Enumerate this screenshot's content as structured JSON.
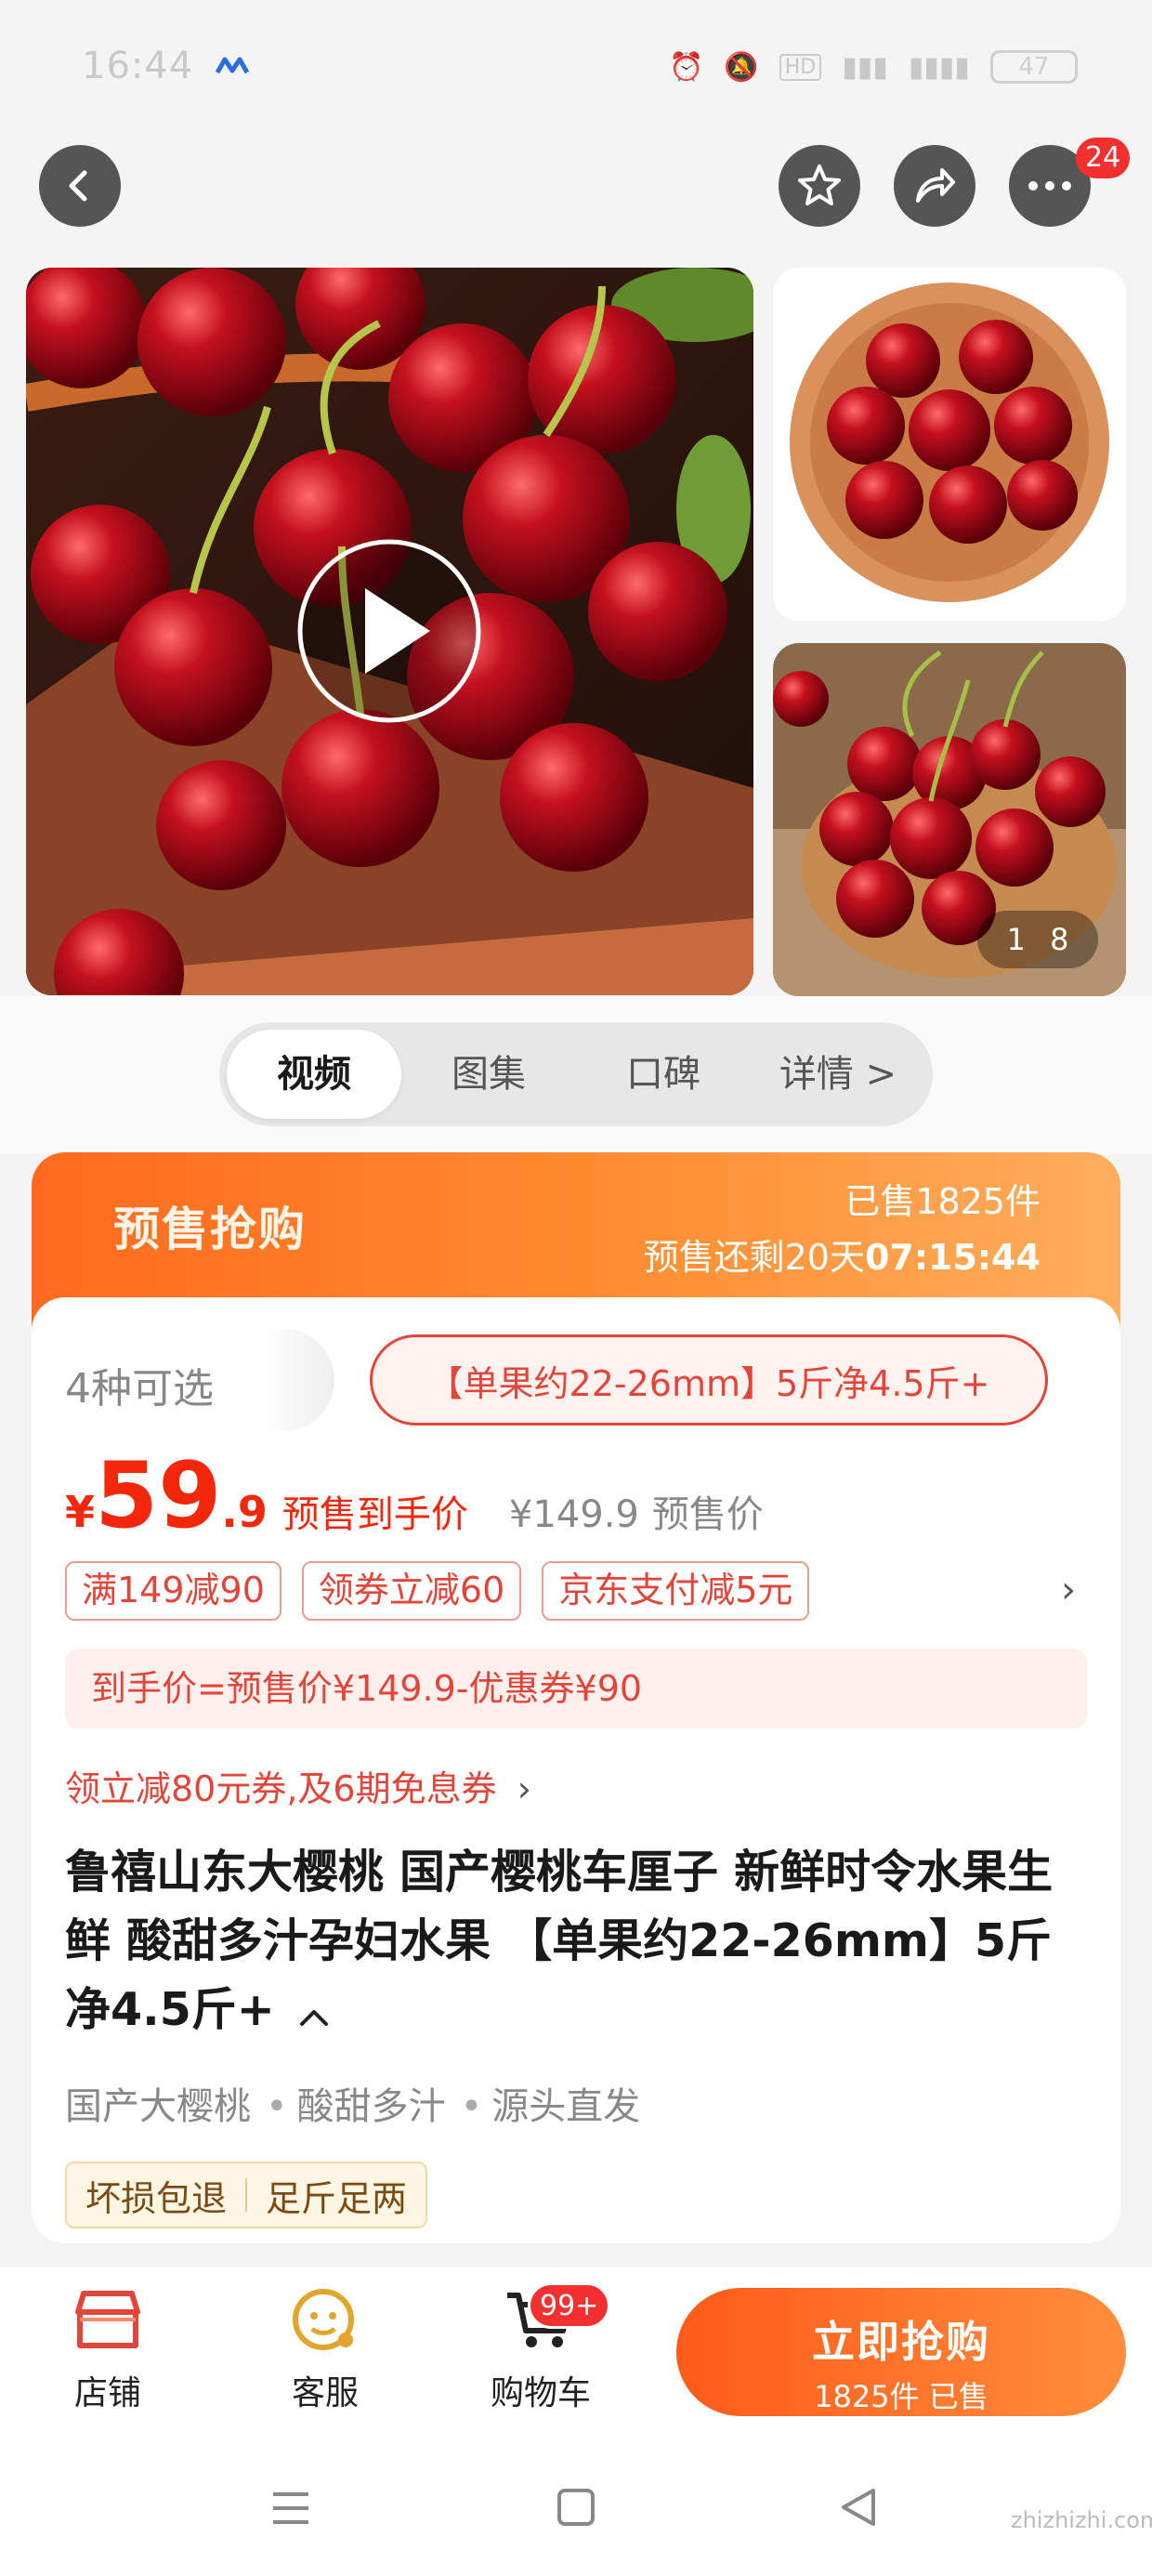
{
  "status_bar": {
    "time": "16:44",
    "battery": "47"
  },
  "nav": {
    "more_badge": "24"
  },
  "gallery": {
    "counter_current": "1",
    "counter_total": "8"
  },
  "tabs": [
    {
      "label": "视频",
      "active": true
    },
    {
      "label": "图集",
      "active": false
    },
    {
      "label": "口碑",
      "active": false
    },
    {
      "label": "详情 >",
      "active": false
    }
  ],
  "presale": {
    "title": "预售抢购",
    "sold": "已售1825件",
    "remaining_prefix": "预售还剩20天",
    "remaining_time": "07:15:44"
  },
  "spec": {
    "count": "4种可选",
    "selected": "【单果约22-26mm】5斤净4.5斤+"
  },
  "price": {
    "currency": "¥",
    "integer": "59",
    "decimal": ".9",
    "label": "预售到手价",
    "original": "¥149.9",
    "original_label": "预售价"
  },
  "coupons": [
    "满149减90",
    "领券立减60",
    "京东支付减5元"
  ],
  "formula": "到手价=预售价¥149.9-优惠券¥90",
  "promo": "领立减80元券,及6期免息券",
  "promo_arrow": "›",
  "product_title": "鲁禧山东大樱桃 国产樱桃车厘子 新鲜时令水果生鲜 酸甜多汁孕妇水果 【单果约22-26mm】5斤净4.5斤+",
  "feature_tags": [
    "国产大樱桃",
    "酸甜多汁",
    "源头直发"
  ],
  "guarantees": [
    "坏损包退",
    "足斤足两"
  ],
  "bottom_bar": {
    "store": "店铺",
    "service": "客服",
    "cart": "购物车",
    "cart_badge": "99+",
    "buy_main": "立即抢购",
    "buy_sub": "1825件 已售"
  },
  "watermark": "zhizhizhi.com",
  "colors": {
    "accent": "#f2270c",
    "presale_orange": "#ff7a2a",
    "coupon_red": "#e2453a"
  }
}
